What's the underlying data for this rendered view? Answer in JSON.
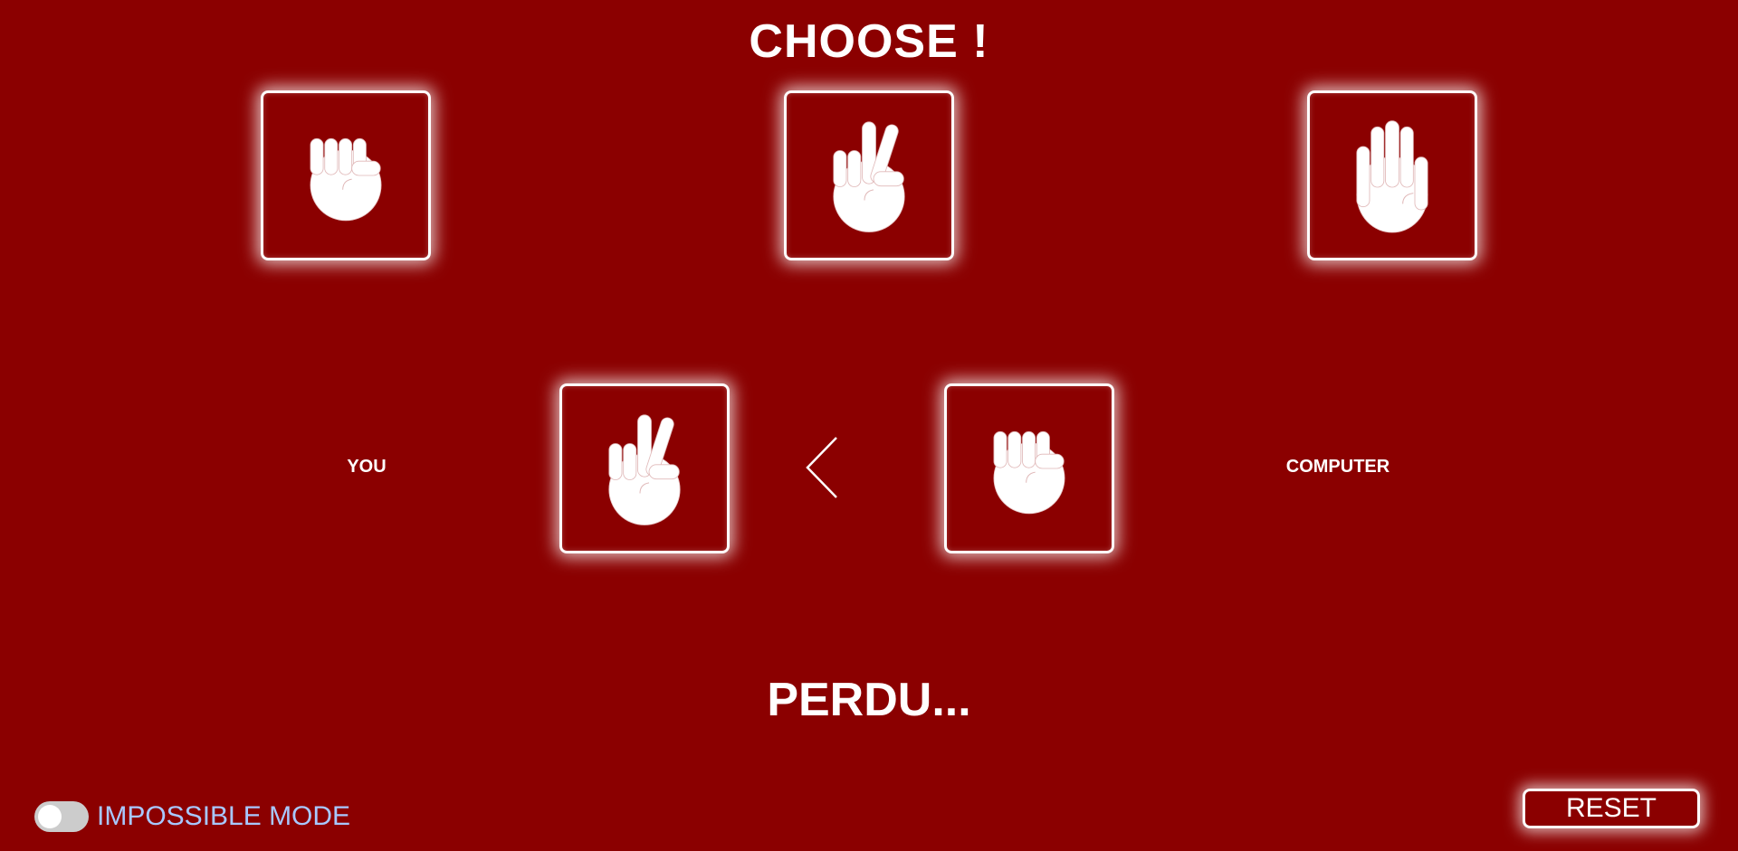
{
  "game": {
    "title": "CHOOSE !",
    "result": "PERDU...",
    "player_label": "YOU",
    "computer_label": "COMPUTER"
  },
  "choices": [
    {
      "icon": "rock-hand-icon"
    },
    {
      "icon": "scissors-hand-icon"
    },
    {
      "icon": "paper-hand-icon"
    }
  ],
  "player_choice": {
    "icon": "scissors-hand-icon"
  },
  "computer_choice": {
    "icon": "rock-hand-icon"
  },
  "comparison": {
    "icon": "less-than-chevron-icon"
  },
  "controls": {
    "impossible_mode_label": "IMPOSSIBLE MODE",
    "impossible_mode_on": false,
    "reset_label": "RESET"
  },
  "colors": {
    "background": "#8b0000",
    "foreground": "#ffffff",
    "toggle_label": "#a8c8ff",
    "toggle_track": "#cccccc"
  }
}
